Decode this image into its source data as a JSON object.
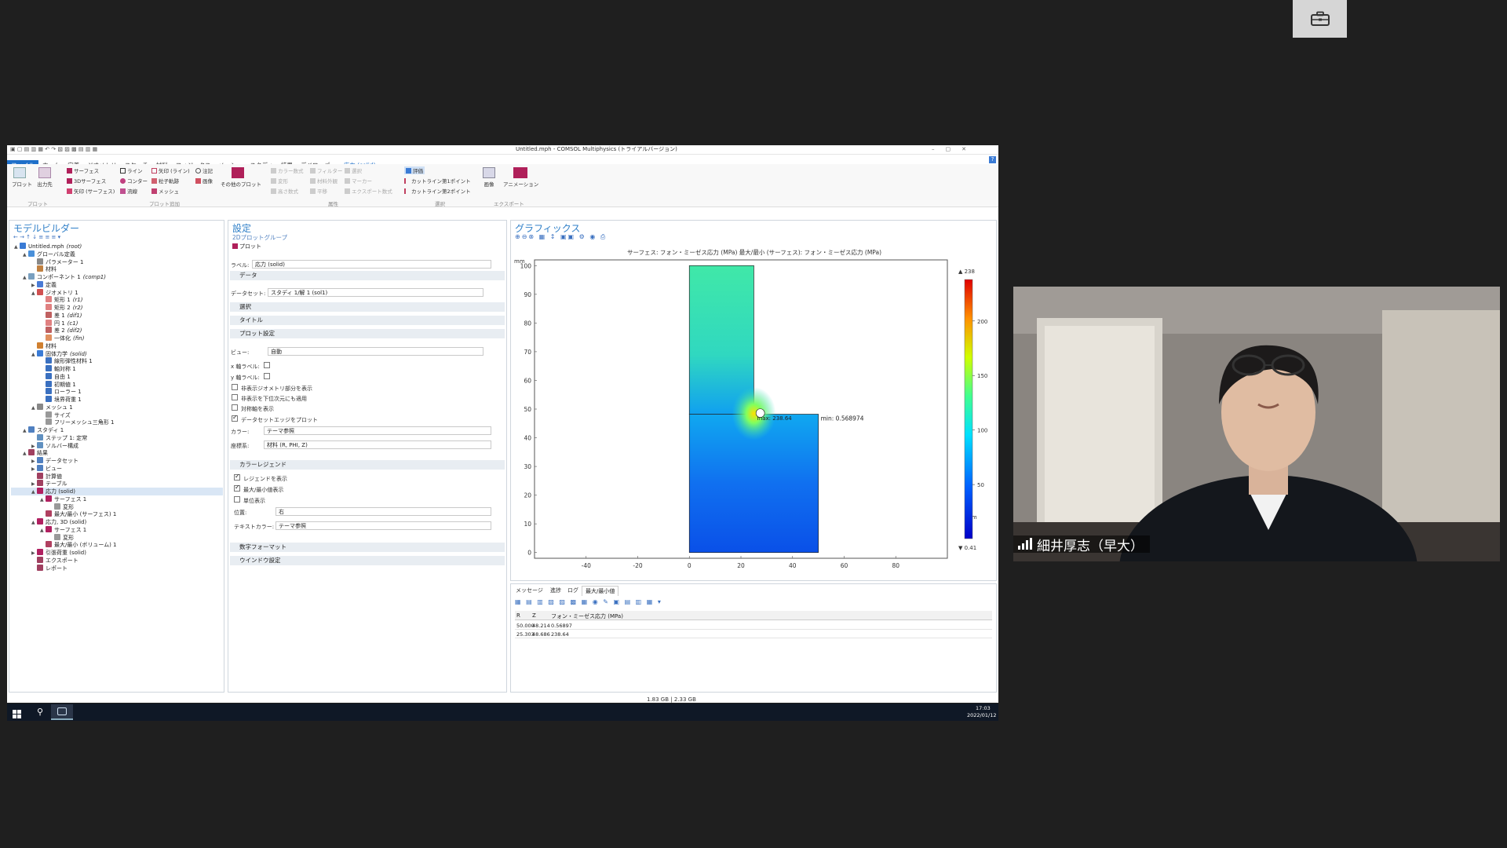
{
  "window": {
    "title": "Untitled.mph - COMSOL Multiphysics (トライアルバージョン)"
  },
  "menu": [
    "ファイル",
    "ホーム",
    "定義",
    "ジオメトリ",
    "スケッチ",
    "材料",
    "フィジックス",
    "メッシュ",
    "スタディ",
    "結果",
    "デベロッパー",
    "応力 (solid)"
  ],
  "ribbon": {
    "plot": "プロット",
    "output": "出力先",
    "group_plot": "プロット",
    "surface": "サーフェス",
    "surface3d": "3Dサーフェス",
    "arrow_surface": "矢印 (サーフェス)",
    "line": "ライン",
    "contour": "コンター",
    "streamline": "流線",
    "arrow_line": "矢印 (ライン)",
    "particle": "粒子軌跡",
    "mesh": "メッシュ",
    "annotation": "注記",
    "image": "画像",
    "other_plots": "その他のプロット",
    "group_add": "プロット追加",
    "color_expr": "カラー数式",
    "deform": "変形",
    "height_expr": "高さ数式",
    "filter": "フィルター",
    "material_appearance": "材料外観",
    "export_expr": "エクスポート数式",
    "selection": "選択",
    "marker": "マーカー",
    "translation": "平移",
    "group_attr": "属性",
    "eval": "評価",
    "cutline1": "カットライン第1ポイント",
    "cutline2": "カットライン第2ポイント",
    "group_select": "選択",
    "image_export": "画像",
    "animation": "アニメーション",
    "group_export": "エクスポート"
  },
  "model_builder": {
    "title": "モデルビルダー",
    "tree": [
      {
        "label": "Untitled.mph",
        "tag": "(root)",
        "lvl": 0,
        "color": "#3a7bd5"
      },
      {
        "label": "グローバル定義",
        "tag": "",
        "lvl": 1,
        "color": "#4a90d9"
      },
      {
        "label": "パラメーター 1",
        "tag": "",
        "lvl": 2,
        "color": "#888888"
      },
      {
        "label": "材料",
        "tag": "",
        "lvl": 2,
        "color": "#c08040"
      },
      {
        "label": "コンポーネント 1",
        "tag": "(comp1)",
        "lvl": 1,
        "color": "#7aa0c0"
      },
      {
        "label": "定義",
        "tag": "",
        "lvl": 2,
        "color": "#4a7bd5"
      },
      {
        "label": "ジオメトリ 1",
        "tag": "",
        "lvl": 2,
        "color": "#d05050"
      },
      {
        "label": "矩形 1",
        "tag": "(r1)",
        "lvl": 3,
        "color": "#e08080"
      },
      {
        "label": "矩形 2",
        "tag": "(r2)",
        "lvl": 3,
        "color": "#e08080"
      },
      {
        "label": "差 1",
        "tag": "(dif1)",
        "lvl": 3,
        "color": "#c06060"
      },
      {
        "label": "円 1",
        "tag": "(c1)",
        "lvl": 3,
        "color": "#e08080"
      },
      {
        "label": "差 2",
        "tag": "(dif2)",
        "lvl": 3,
        "color": "#c06060"
      },
      {
        "label": "一体化",
        "tag": "(fin)",
        "lvl": 3,
        "color": "#e09060"
      },
      {
        "label": "材料",
        "tag": "",
        "lvl": 2,
        "color": "#d08030"
      },
      {
        "label": "固体力学",
        "tag": "(solid)",
        "lvl": 2,
        "color": "#3a7bd5"
      },
      {
        "label": "線形弾性材料 1",
        "tag": "",
        "lvl": 3,
        "color": "#3a70c0"
      },
      {
        "label": "軸対称 1",
        "tag": "",
        "lvl": 3,
        "color": "#3a70c0"
      },
      {
        "label": "自由 1",
        "tag": "",
        "lvl": 3,
        "color": "#3a70c0"
      },
      {
        "label": "初期値 1",
        "tag": "",
        "lvl": 3,
        "color": "#3a70c0"
      },
      {
        "label": "ローラー 1",
        "tag": "",
        "lvl": 3,
        "color": "#3a70c0"
      },
      {
        "label": "境界荷重 1",
        "tag": "",
        "lvl": 3,
        "color": "#3a70c0"
      },
      {
        "label": "メッシュ 1",
        "tag": "",
        "lvl": 2,
        "color": "#888888"
      },
      {
        "label": "サイズ",
        "tag": "",
        "lvl": 3,
        "color": "#999999"
      },
      {
        "label": "フリーメッシュ三角形 1",
        "tag": "",
        "lvl": 3,
        "color": "#999999"
      },
      {
        "label": "スタディ 1",
        "tag": "",
        "lvl": 1,
        "color": "#5080c0"
      },
      {
        "label": "ステップ 1: 定常",
        "tag": "",
        "lvl": 2,
        "color": "#6090c0"
      },
      {
        "label": "ソルバー構成",
        "tag": "",
        "lvl": 2,
        "color": "#6090c0"
      },
      {
        "label": "結果",
        "tag": "",
        "lvl": 1,
        "color": "#a04060"
      },
      {
        "label": "データセット",
        "tag": "",
        "lvl": 2,
        "color": "#5080c0"
      },
      {
        "label": "ビュー",
        "tag": "",
        "lvl": 2,
        "color": "#5080c0"
      },
      {
        "label": "計算値",
        "tag": "",
        "lvl": 2,
        "color": "#a04060"
      },
      {
        "label": "テーブル",
        "tag": "",
        "lvl": 2,
        "color": "#a04060"
      },
      {
        "label": "応力 (solid)",
        "tag": "",
        "lvl": 2,
        "color": "#b02060"
      },
      {
        "label": "サーフェス 1",
        "tag": "",
        "lvl": 3,
        "color": "#b02060"
      },
      {
        "label": "変形",
        "tag": "",
        "lvl": 4,
        "color": "#999999"
      },
      {
        "label": "最大/最小 (サーフェス) 1",
        "tag": "",
        "lvl": 3,
        "color": "#b04060"
      },
      {
        "label": "応力, 3D (solid)",
        "tag": "",
        "lvl": 2,
        "color": "#b02060"
      },
      {
        "label": "サーフェス 1",
        "tag": "",
        "lvl": 3,
        "color": "#b02060"
      },
      {
        "label": "変形",
        "tag": "",
        "lvl": 4,
        "color": "#999999"
      },
      {
        "label": "最大/最小 (ボリューム) 1",
        "tag": "",
        "lvl": 3,
        "color": "#b04060"
      },
      {
        "label": "引張荷重 (solid)",
        "tag": "",
        "lvl": 2,
        "color": "#b02060"
      },
      {
        "label": "エクスポート",
        "tag": "",
        "lvl": 2,
        "color": "#a04060"
      },
      {
        "label": "レポート",
        "tag": "",
        "lvl": 2,
        "color": "#a04060"
      }
    ]
  },
  "settings": {
    "title": "設定",
    "subtitle": "2Dプロットグループ",
    "plot_btn": "プロット",
    "label_caption": "ラベル:",
    "label_value": "応力 (solid)",
    "sec_data": "データ",
    "dataset_caption": "データセット:",
    "dataset_value": "スタディ 1/解 1 (sol1)",
    "sec_selection": "選択",
    "sec_title": "タイトル",
    "sec_plot_settings": "プロット設定",
    "view_caption": "ビュー:",
    "view_value": "自動",
    "xlabel_caption": "x 軸ラベル:",
    "ylabel_caption": "y 軸ラベル:",
    "chk_hidden_geom": "非表示ジオメトリ部分を表示",
    "chk_hidden_lower": "非表示を下位次元にも適用",
    "chk_mirror": "対称軸を表示",
    "chk_edges": "データセットエッジをプロット",
    "color_caption": "カラー:",
    "color_value": "テーマ参照",
    "frame_caption": "座標系:",
    "frame_value": "材料 (R, PHI, Z)",
    "sec_legend": "カラーレジェンド",
    "chk_show_legend": "レジェンドを表示",
    "chk_show_maxmin": "最大/最小値表示",
    "chk_units": "単位表示",
    "pos_caption": "位置:",
    "pos_value": "右",
    "textcolor_caption": "テキストカラー:",
    "textcolor_value": "テーマ参照",
    "sec_number_format": "数字フォーマット",
    "sec_window": "ウインドウ設定"
  },
  "graphics": {
    "title": "グラフィックス",
    "plot_title": "サーフェス: フォン・ミーゼス応力 (MPa)  最大/最小 (サーフェス): フォン・ミーゼス応力 (MPa)",
    "y_unit": "mm",
    "x_unit": "mm",
    "min_label": "min: 0.568974",
    "max_label": "max: 238.64",
    "legend_max": "▲ 238",
    "legend_min": "▼ 0.41"
  },
  "chart_data": {
    "type": "heatmap",
    "title": "サーフェス: フォン・ミーゼス応力 (MPa)  最大/最小 (サーフェス): フォン・ミーゼス応力 (MPa)",
    "xlabel": "mm",
    "ylabel": "mm",
    "xlim": [
      -60,
      100
    ],
    "ylim": [
      -2,
      102
    ],
    "xticks": [
      -40,
      -20,
      0,
      20,
      40,
      60,
      80
    ],
    "yticks": [
      0,
      10,
      20,
      30,
      40,
      50,
      60,
      70,
      80,
      90,
      100
    ],
    "colorbar_ticks": [
      50,
      100,
      150,
      200
    ],
    "colorbar_range": [
      0.41,
      238
    ],
    "min_point": {
      "x": 50,
      "y": 48.214,
      "value": 0.56897
    },
    "max_point": {
      "x": 25.303,
      "y": 48.686,
      "value": 238.64
    }
  },
  "messages": {
    "tabs": [
      "メッセージ",
      "進捗",
      "ログ",
      "最大/最小値"
    ],
    "columns": [
      "R",
      "Z",
      "フォン・ミーゼス応力 (MPa)"
    ],
    "rows": [
      [
        "50.000",
        "48.214",
        "0.56897"
      ],
      [
        "25.303",
        "48.686",
        "238.64"
      ]
    ]
  },
  "status": {
    "memory": "1.83 GB | 2.33 GB"
  },
  "taskbar": {
    "time": "17:03",
    "date": "2022/01/12"
  },
  "video": {
    "name": "細井厚志（早大）"
  }
}
